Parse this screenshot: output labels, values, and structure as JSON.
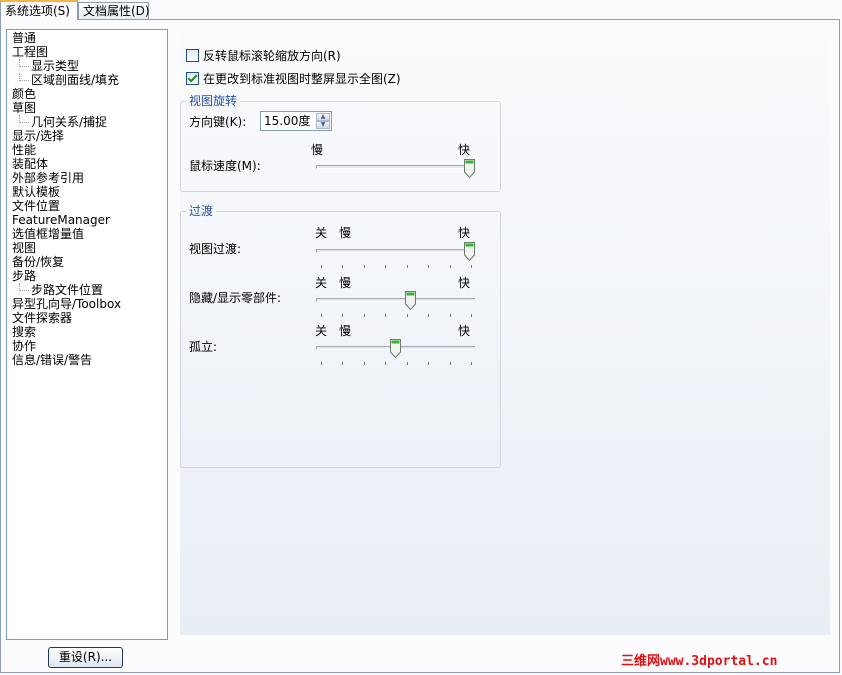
{
  "tabs": [
    {
      "label": "系统选项(S)",
      "active": true
    },
    {
      "label": "文档属性(D)",
      "active": false
    }
  ],
  "tree": [
    {
      "label": "普通",
      "level": 0
    },
    {
      "label": "工程图",
      "level": 0
    },
    {
      "label": "显示类型",
      "level": 1
    },
    {
      "label": "区域剖面线/填充",
      "level": 1
    },
    {
      "label": "颜色",
      "level": 0
    },
    {
      "label": "草图",
      "level": 0
    },
    {
      "label": "几何关系/捕捉",
      "level": 1
    },
    {
      "label": "显示/选择",
      "level": 0
    },
    {
      "label": "性能",
      "level": 0
    },
    {
      "label": "装配体",
      "level": 0
    },
    {
      "label": "外部参考引用",
      "level": 0
    },
    {
      "label": "默认模板",
      "level": 0
    },
    {
      "label": "文件位置",
      "level": 0
    },
    {
      "label": "FeatureManager",
      "level": 0
    },
    {
      "label": "选值框增量值",
      "level": 0
    },
    {
      "label": "视图",
      "level": 0
    },
    {
      "label": "备份/恢复",
      "level": 0
    },
    {
      "label": "步路",
      "level": 0
    },
    {
      "label": "步路文件位置",
      "level": 1
    },
    {
      "label": "异型孔向导/Toolbox",
      "level": 0
    },
    {
      "label": "文件探索器",
      "level": 0
    },
    {
      "label": "搜索",
      "level": 0
    },
    {
      "label": "协作",
      "level": 0
    },
    {
      "label": "信息/错误/警告",
      "level": 0
    }
  ],
  "reset_button": "重设(R)...",
  "options": {
    "reverse_wheel": {
      "label": "反转鼠标滚轮缩放方向(R)",
      "checked": false
    },
    "zoom_to_fit": {
      "label": "在更改到标准视图时整屏显示全图(Z)",
      "checked": true
    }
  },
  "rotation_group": {
    "title": "视图旋转",
    "arrow_keys_label": "方向键(K):",
    "arrow_keys_value": "15.00度",
    "mouse_speed_label": "鼠标速度(M):",
    "slow": "慢",
    "fast": "快",
    "mouse_speed_position": 1.0
  },
  "transition_group": {
    "title": "过渡",
    "off": "关",
    "slow": "慢",
    "fast": "快",
    "sliders": [
      {
        "label": "视图过渡:",
        "position": 1.0
      },
      {
        "label": "隐藏/显示零部件:",
        "position": 0.6
      },
      {
        "label": "孤立:",
        "position": 0.5
      }
    ]
  },
  "watermark": "三维网www.3dportal.cn"
}
